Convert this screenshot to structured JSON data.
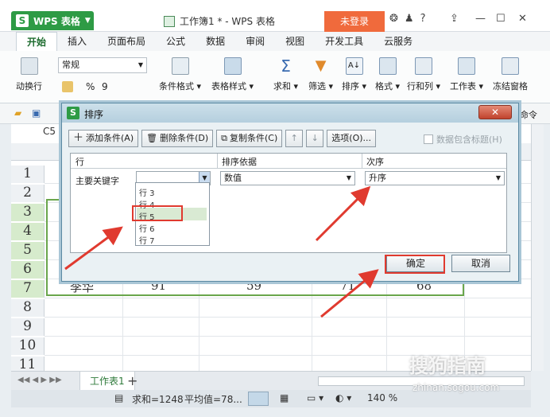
{
  "app": {
    "name": "WPS 表格",
    "logo": "S",
    "document_title": "工作簿1 * - WPS 表格",
    "login_label": "未登录"
  },
  "ribbon_tabs": [
    "开始",
    "插入",
    "页面布局",
    "公式",
    "数据",
    "审阅",
    "视图",
    "开发工具",
    "云服务"
  ],
  "ribbon": {
    "wrap_label": "动换行",
    "font_name": "常规",
    "percent": "%",
    "comma": "9",
    "buttons": [
      "条件格式",
      "表格样式",
      "求和",
      "筛选",
      "排序",
      "格式",
      "行和列",
      "工作表",
      "冻结窗格"
    ],
    "overflow_label": "命令"
  },
  "cell_ref": "C5",
  "grid": {
    "row_numbers": [
      "1",
      "2",
      "3",
      "4",
      "5",
      "6",
      "7",
      "8",
      "9",
      "10",
      "11"
    ],
    "row7_values": [
      "李华",
      "91",
      "59",
      "71",
      "68"
    ]
  },
  "sheet_tab": "工作表1",
  "add_sheet_label": "+",
  "status": {
    "sum": "求和=1248",
    "avg": "平均值=78...",
    "zoom": "140 %"
  },
  "dialog": {
    "logo": "S",
    "title": "排序",
    "add_condition": "添加条件(A)",
    "delete_condition": "删除条件(D)",
    "copy_condition": "复制条件(C)",
    "options": "选项(O)...",
    "header_checkbox": "数据包含标题(H)",
    "col_row": "行",
    "col_basis": "排序依据",
    "col_order": "次序",
    "primary_key": "主要关键字",
    "basis_value": "数值",
    "order_value": "升序",
    "list_items": [
      "行 3",
      "行 4",
      "行 5",
      "行 6",
      "行 7"
    ],
    "ok": "确定",
    "cancel": "取消"
  },
  "watermark": {
    "brand": "搜狗指南",
    "url": "zhinan.sogou.com"
  }
}
